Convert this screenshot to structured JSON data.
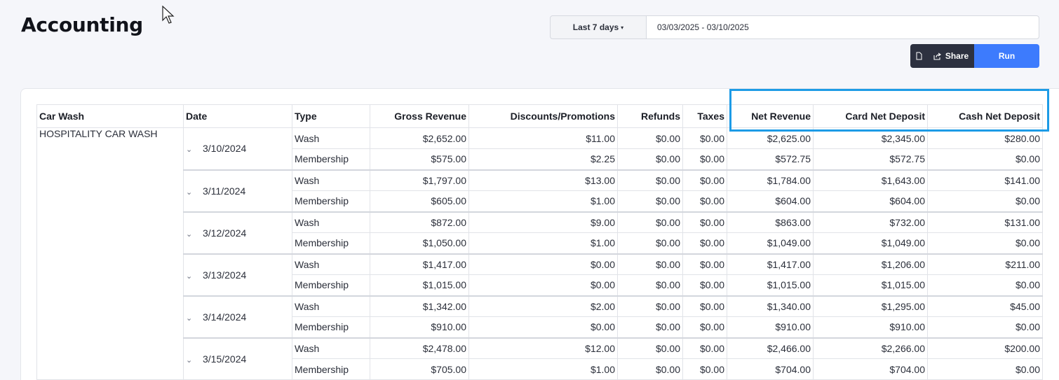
{
  "header": {
    "title": "Accounting"
  },
  "filters": {
    "range_label": "Last 7 days",
    "date_range_value": "03/03/2025 - 03/10/2025"
  },
  "actions": {
    "share_label": "Share",
    "run_label": "Run"
  },
  "colors": {
    "run_button": "#3d7bfd",
    "action_dark": "#2d3140",
    "highlight": "#1d9be6"
  },
  "table": {
    "columns": [
      "Car Wash",
      "Date",
      "Type",
      "Gross Revenue",
      "Discounts/Promotions",
      "Refunds",
      "Taxes",
      "Net Revenue",
      "Card Net Deposit",
      "Cash Net Deposit"
    ],
    "car_wash": "HOSPITALITY CAR WASH",
    "groups": [
      {
        "date": "3/10/2024",
        "rows": [
          [
            "Wash",
            "$2,652.00",
            "$11.00",
            "$0.00",
            "$0.00",
            "$2,625.00",
            "$2,345.00",
            "$280.00"
          ],
          [
            "Membership",
            "$575.00",
            "$2.25",
            "$0.00",
            "$0.00",
            "$572.75",
            "$572.75",
            "$0.00"
          ]
        ]
      },
      {
        "date": "3/11/2024",
        "rows": [
          [
            "Wash",
            "$1,797.00",
            "$13.00",
            "$0.00",
            "$0.00",
            "$1,784.00",
            "$1,643.00",
            "$141.00"
          ],
          [
            "Membership",
            "$605.00",
            "$1.00",
            "$0.00",
            "$0.00",
            "$604.00",
            "$604.00",
            "$0.00"
          ]
        ]
      },
      {
        "date": "3/12/2024",
        "rows": [
          [
            "Wash",
            "$872.00",
            "$9.00",
            "$0.00",
            "$0.00",
            "$863.00",
            "$732.00",
            "$131.00"
          ],
          [
            "Membership",
            "$1,050.00",
            "$1.00",
            "$0.00",
            "$0.00",
            "$1,049.00",
            "$1,049.00",
            "$0.00"
          ]
        ]
      },
      {
        "date": "3/13/2024",
        "rows": [
          [
            "Wash",
            "$1,417.00",
            "$0.00",
            "$0.00",
            "$0.00",
            "$1,417.00",
            "$1,206.00",
            "$211.00"
          ],
          [
            "Membership",
            "$1,015.00",
            "$0.00",
            "$0.00",
            "$0.00",
            "$1,015.00",
            "$1,015.00",
            "$0.00"
          ]
        ]
      },
      {
        "date": "3/14/2024",
        "rows": [
          [
            "Wash",
            "$1,342.00",
            "$2.00",
            "$0.00",
            "$0.00",
            "$1,340.00",
            "$1,295.00",
            "$45.00"
          ],
          [
            "Membership",
            "$910.00",
            "$0.00",
            "$0.00",
            "$0.00",
            "$910.00",
            "$910.00",
            "$0.00"
          ]
        ]
      },
      {
        "date": "3/15/2024",
        "rows": [
          [
            "Wash",
            "$2,478.00",
            "$12.00",
            "$0.00",
            "$0.00",
            "$2,466.00",
            "$2,266.00",
            "$200.00"
          ],
          [
            "Membership",
            "$705.00",
            "$1.00",
            "$0.00",
            "$0.00",
            "$704.00",
            "$704.00",
            "$0.00"
          ]
        ]
      }
    ]
  }
}
